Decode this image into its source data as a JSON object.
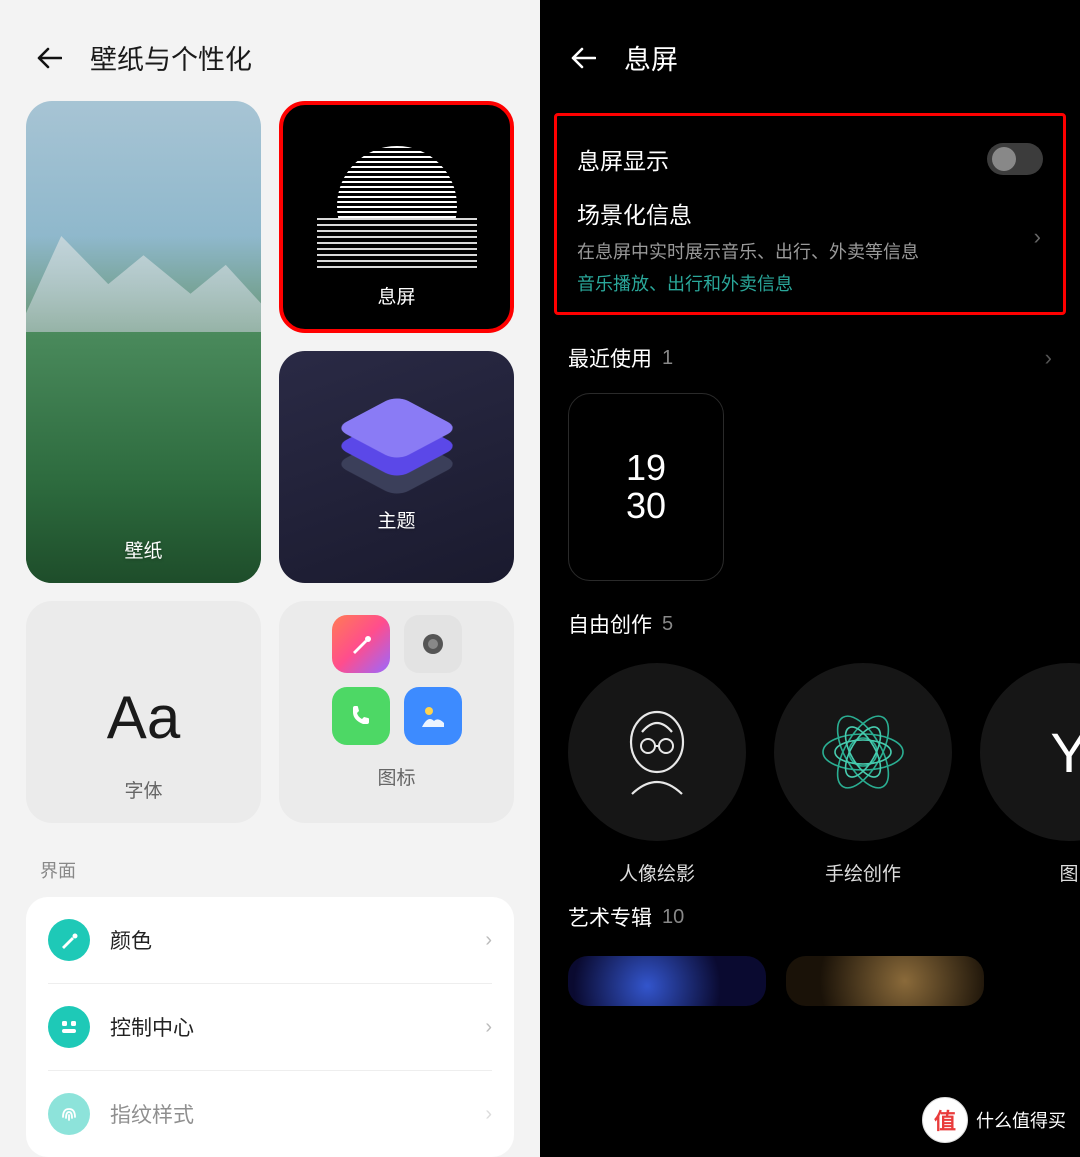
{
  "left": {
    "title": "壁纸与个性化",
    "cards": {
      "wallpaper": "壁纸",
      "aod": "息屏",
      "theme": "主题",
      "font_symbol": "Aa",
      "font": "字体",
      "icons": "图标"
    },
    "section_ui": "界面",
    "list": {
      "color": "颜色",
      "control_center": "控制中心",
      "fingerprint": "指纹样式"
    }
  },
  "right": {
    "title": "息屏",
    "aod_display": "息屏显示",
    "scene": {
      "title": "场景化信息",
      "desc": "在息屏中实时展示音乐、出行、外卖等信息",
      "link": "音乐播放、出行和外卖信息"
    },
    "recent": {
      "title": "最近使用",
      "count": "1",
      "clock_top": "19",
      "clock_bottom": "30"
    },
    "free": {
      "title": "自由创作",
      "count": "5",
      "items": [
        "人像绘影",
        "手绘创作",
        "图"
      ]
    },
    "art": {
      "title": "艺术专辑",
      "count": "10"
    }
  },
  "watermark": {
    "badge": "值",
    "text": "什么值得买"
  }
}
